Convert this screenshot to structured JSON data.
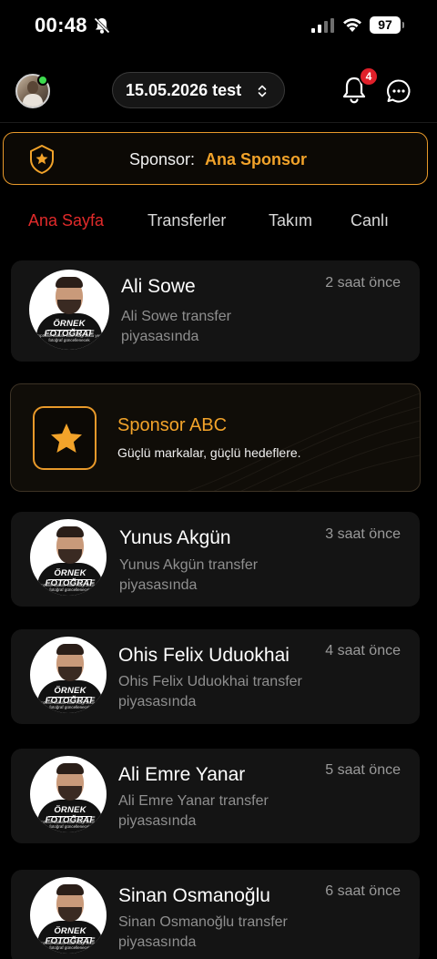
{
  "status_bar": {
    "time": "00:48",
    "battery": "97"
  },
  "header": {
    "date_selector": "15.05.2026 test",
    "notification_count": "4"
  },
  "sponsor_bar": {
    "label": "Sponsor:",
    "name": "Ana Sponsor"
  },
  "tabs": [
    {
      "label": "Ana Sayfa",
      "active": true
    },
    {
      "label": "Transferler",
      "active": false
    },
    {
      "label": "Takım",
      "active": false
    },
    {
      "label": "Canlı",
      "active": false
    }
  ],
  "photo_watermark": {
    "title": "ÖRNEK FOTOĞRAF",
    "caption": "TopSekk hakları elde ettiği anda yeni fotoğraf güncellenecek"
  },
  "feed": [
    {
      "name": "Ali Sowe",
      "time": "2 saat önce",
      "desc": "Ali Sowe transfer piyasasında"
    },
    {
      "name": "Yunus Akgün",
      "time": "3 saat önce",
      "desc": "Yunus Akgün transfer piyasasında"
    },
    {
      "name": "Ohis Felix Uduokhai",
      "time": "4 saat önce",
      "desc": "Ohis Felix Uduokhai transfer piyasasında"
    },
    {
      "name": "Ali Emre Yanar",
      "time": "5 saat önce",
      "desc": "Ali Emre Yanar transfer piyasasında"
    },
    {
      "name": "Sinan Osmanoğlu",
      "time": "6 saat önce",
      "desc": "Sinan Osmanoğlu transfer piyasasında"
    }
  ],
  "promo": {
    "title": "Sponsor ABC",
    "subtitle": "Güçlü markalar, güçlü hedeflere."
  },
  "colors": {
    "accent_orange": "#f2a32a",
    "active_tab_red": "#e02a2a",
    "card_bg": "#141414",
    "background": "#000000"
  }
}
